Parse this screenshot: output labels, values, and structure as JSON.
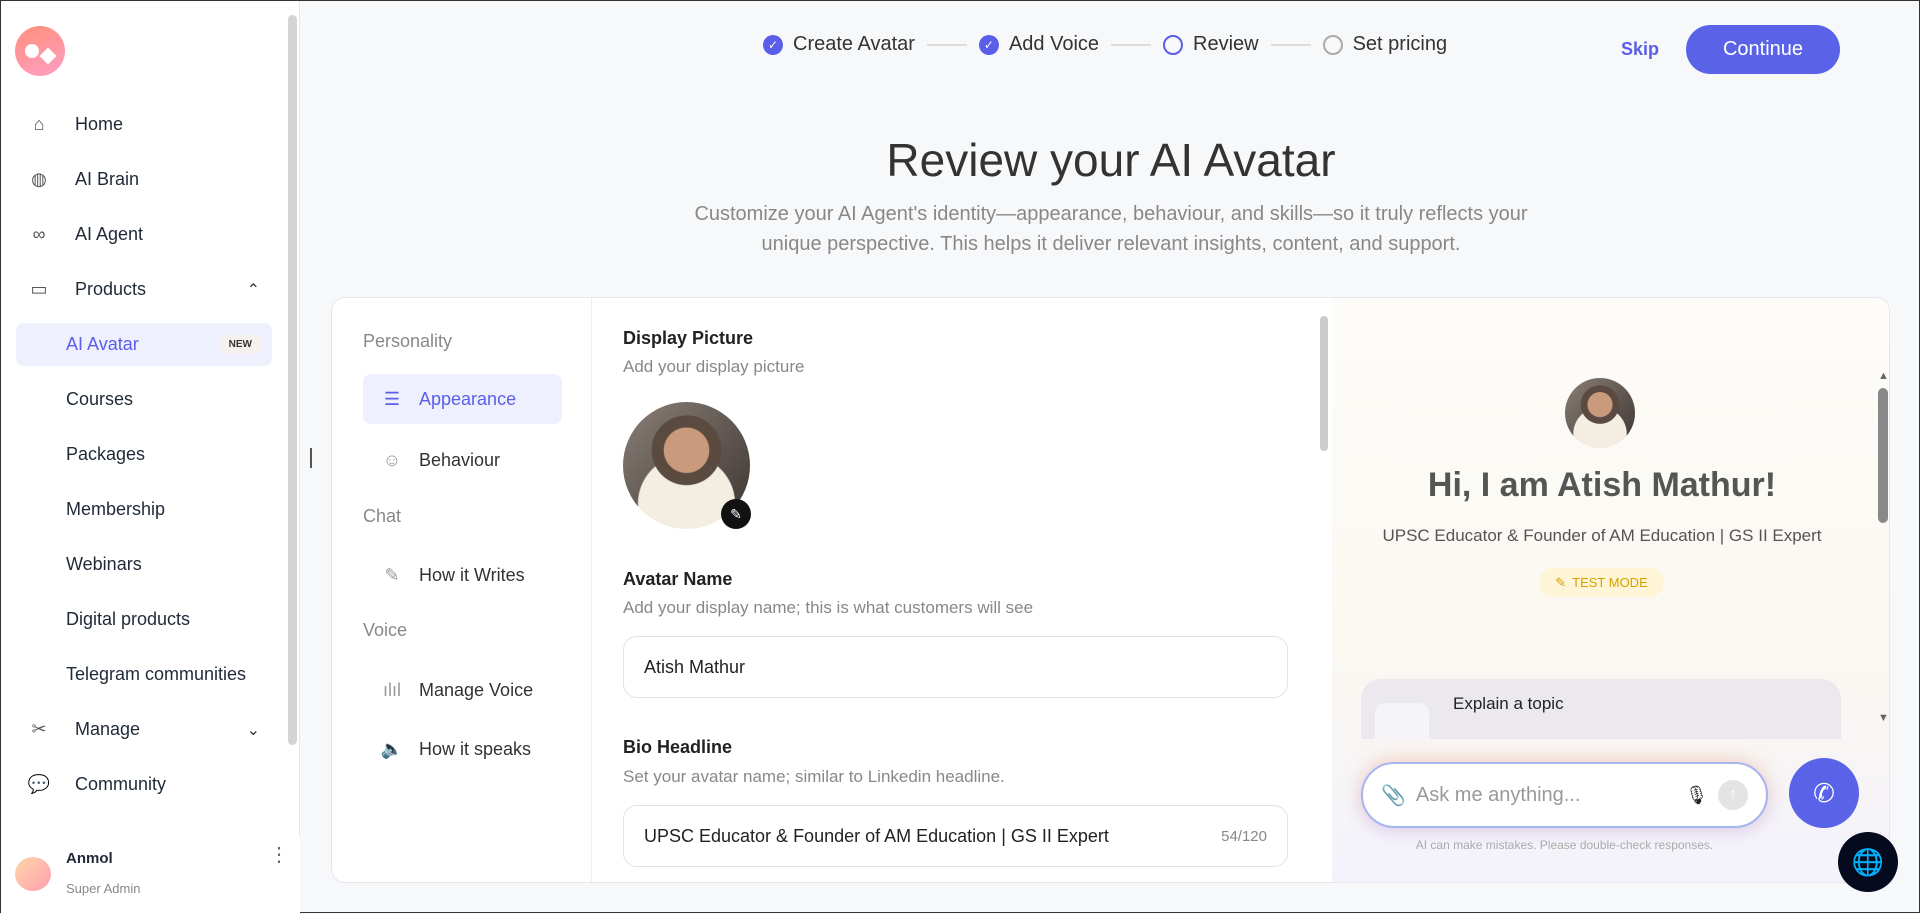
{
  "sidebar": {
    "items": [
      {
        "label": "Home",
        "icon": "home-icon",
        "glyph": "⌂"
      },
      {
        "label": "AI Brain",
        "icon": "brain-icon",
        "glyph": "◍"
      },
      {
        "label": "AI Agent",
        "icon": "infinity-icon",
        "glyph": "∞"
      },
      {
        "label": "Products",
        "icon": "archive-icon",
        "glyph": "▭",
        "chevron": "⌃"
      },
      {
        "label": "AI Avatar",
        "badge": "NEW"
      },
      {
        "label": "Courses"
      },
      {
        "label": "Packages"
      },
      {
        "label": "Membership"
      },
      {
        "label": "Webinars"
      },
      {
        "label": "Digital products"
      },
      {
        "label": "Telegram communities"
      },
      {
        "label": "Manage",
        "icon": "tools-icon",
        "glyph": "✂",
        "chevron": "⌄"
      },
      {
        "label": "Community",
        "icon": "chat-icon",
        "glyph": "💬"
      }
    ],
    "user": {
      "name": "Anmol",
      "role": "Super Admin"
    }
  },
  "stepper": {
    "steps": [
      {
        "label": "Create Avatar",
        "state": "done"
      },
      {
        "label": "Add Voice",
        "state": "done"
      },
      {
        "label": "Review",
        "state": "current"
      },
      {
        "label": "Set pricing",
        "state": "todo"
      }
    ]
  },
  "header": {
    "skip": "Skip",
    "continue": "Continue"
  },
  "page": {
    "title": "Review your AI Avatar",
    "subtitle_1": "Customize your AI Agent's identity—appearance, behaviour, and skills—so it truly reflects your",
    "subtitle_2": "unique perspective. This helps it deliver relevant insights, content, and support."
  },
  "settings_nav": {
    "personality": "Personality",
    "appearance": "Appearance",
    "behaviour": "Behaviour",
    "chat": "Chat",
    "how_it_writes": "How it Writes",
    "voice": "Voice",
    "manage_voice": "Manage Voice",
    "how_it_speaks": "How it speaks"
  },
  "form": {
    "display_picture": {
      "label": "Display Picture",
      "help": "Add your display picture"
    },
    "avatar_name": {
      "label": "Avatar Name",
      "help": "Add your display name; this is what customers will see",
      "value": "Atish Mathur"
    },
    "bio_headline": {
      "label": "Bio Headline",
      "help": "Set your avatar name; similar to Linkedin headline.",
      "value": "UPSC Educator & Founder of AM Education | GS II Expert",
      "counter": "54/120"
    }
  },
  "preview": {
    "greeting": "Hi, I am Atish Mathur!",
    "headline": "UPSC Educator & Founder of AM Education | GS II Expert",
    "test_mode": "TEST MODE",
    "suggestion": "Explain a topic",
    "input_placeholder": "Ask me anything...",
    "disclaimer": "AI can make mistakes. Please double-check responses."
  },
  "colors": {
    "accent": "#5a63e8"
  }
}
